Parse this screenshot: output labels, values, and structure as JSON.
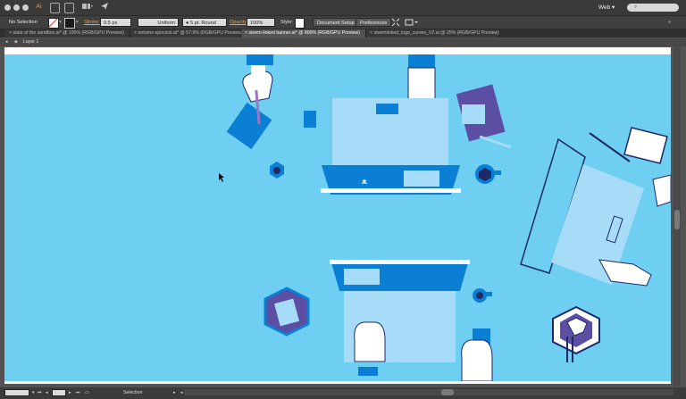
{
  "app": {
    "icon_label": "Ai",
    "workspace": "Web",
    "search_placeholder": "⌕"
  },
  "control_bar": {
    "selection_label": "No Selection",
    "stroke_label": "Stroke:",
    "stroke_weight": "0.5 px",
    "profile": "Uniform",
    "brush": "5 pt. Round",
    "opacity_label": "Opacity:",
    "opacity_value": "100%",
    "style_label": "Style:",
    "document_setup": "Document Setup",
    "preferences": "Preferences"
  },
  "tabs": [
    {
      "label": "state of the sandbox.ai* @ 100% (RGB/GPU Preview)",
      "active": false
    },
    {
      "label": "entorno ejercicio.ai* @ 57,9% (RGB/GPU Preview)",
      "active": false
    },
    {
      "label": "steem-linked banner.ai* @ 800% (RGB/GPU Preview)",
      "active": true
    },
    {
      "label": "steemlinked_logo_curves_V2.ai @ 25% (RGB/GPU Preview)",
      "active": false
    }
  ],
  "layer": {
    "label": "Layer 1"
  },
  "status": {
    "zoom": "800%",
    "page": "1",
    "tool": "Selection"
  },
  "colors": {
    "artboard_bg": "#6ecff2",
    "dark_blue": "#0a7fd4",
    "light_blue": "#a6dcf7",
    "purple": "#5b4ea3",
    "navy": "#1c2a66"
  },
  "icons": [
    "close-icon",
    "gear-icon",
    "search-icon",
    "layer-icon",
    "arrow-icon"
  ]
}
